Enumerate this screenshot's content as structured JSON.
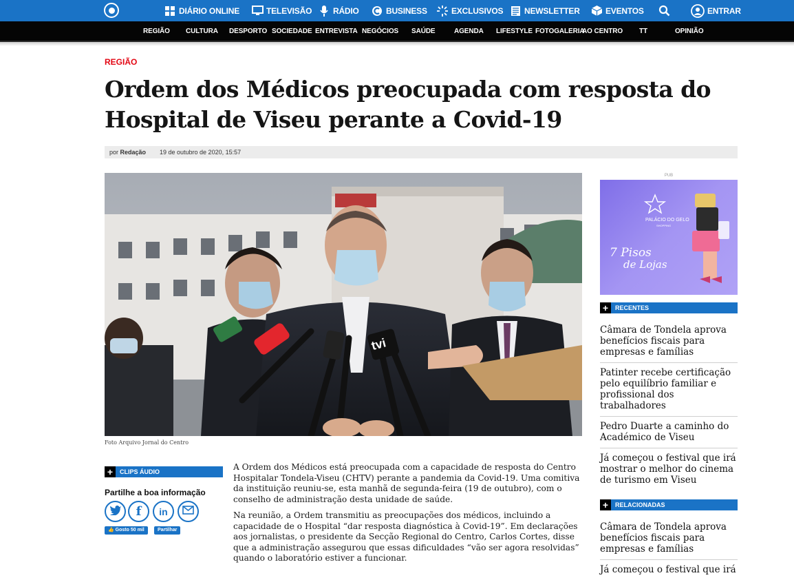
{
  "topnav": {
    "diario": "DIÁRIO ONLINE",
    "televisao": "TELEVISÃO",
    "radio": "RÁDIO",
    "business": "BUSINESS",
    "exclusivos": "EXCLUSIVOS",
    "newsletter": "NEWSLETTER",
    "eventos": "EVENTOS",
    "entrar": "ENTRAR"
  },
  "subnav": [
    "REGIÃO",
    "CULTURA",
    "DESPORTO",
    "SOCIEDADE",
    "ENTREVISTA",
    "NEGÓCIOS",
    "SAÚDE",
    "AGENDA",
    "LIFESTYLE",
    "FOTOGALERIA",
    "AO CENTRO",
    "TT",
    "OPINIÃO"
  ],
  "article": {
    "category": "REGIÃO",
    "title_line1": "Ordem dos Médicos preocupada com resposta do",
    "title_line2": "Hospital de Viseu perante a Covid-19",
    "byline_prefix": "por",
    "author": "Redação",
    "date": "19 de outubro de 2020, 15:57",
    "caption": "Foto Arquivo Jornal do Centro",
    "mic_logo": "tvi",
    "paragraphs": [
      "A Ordem dos Médicos está preocupada com a capacidade de resposta do Centro Hospitalar Tondela-Viseu (CHTV) perante a pandemia da Covid-19. Uma comitiva da instituição reuniu-se, esta manhã de segunda-feira (19 de outubro), com o conselho de administração desta unidade de saúde.",
      "Na reunião, a Ordem transmitiu as preocupações dos médicos, incluindo a capacidade de o Hospital “dar resposta diagnóstica à Covid-19”. Em declarações aos jornalistas, o presidente da Secção Regional do Centro, Carlos Cortes, disse que a administração assegurou que essas dificuldades “vão ser agora resolvidas” quando o laboratório estiver a funcionar."
    ]
  },
  "left": {
    "clips": "CLIPS ÁUDIO",
    "share_title": "Partilhe a boa informação",
    "like_label": "Gosto 50 mil",
    "share_label": "Partilhar"
  },
  "sidebar": {
    "pub": "PUB",
    "ad_brand": "PALÁCIO DO GELO",
    "ad_sub": "SHOPPING",
    "ad_slogan1": "7 Pisos",
    "ad_slogan2": "de Lojas",
    "recentes_title": "RECENTES",
    "recentes": [
      "Câmara de Tondela aprova benefícios fiscais para empresas e famílias",
      "Patinter recebe certificação pelo equilíbrio familiar e profissional dos trabalhadores",
      "Pedro Duarte a caminho do Académico de Viseu",
      "Já começou o festival que irá mostrar o melhor do cinema de turismo em Viseu"
    ],
    "relacionadas_title": "RELACIONADAS",
    "relacionadas": [
      "Câmara de Tondela aprova benefícios fiscais para empresas e famílias",
      "Já começou o festival que irá"
    ]
  },
  "colors": {
    "brand_blue": "#1a73c6",
    "category_red": "#e30613",
    "subnav_bg": "#050505"
  }
}
